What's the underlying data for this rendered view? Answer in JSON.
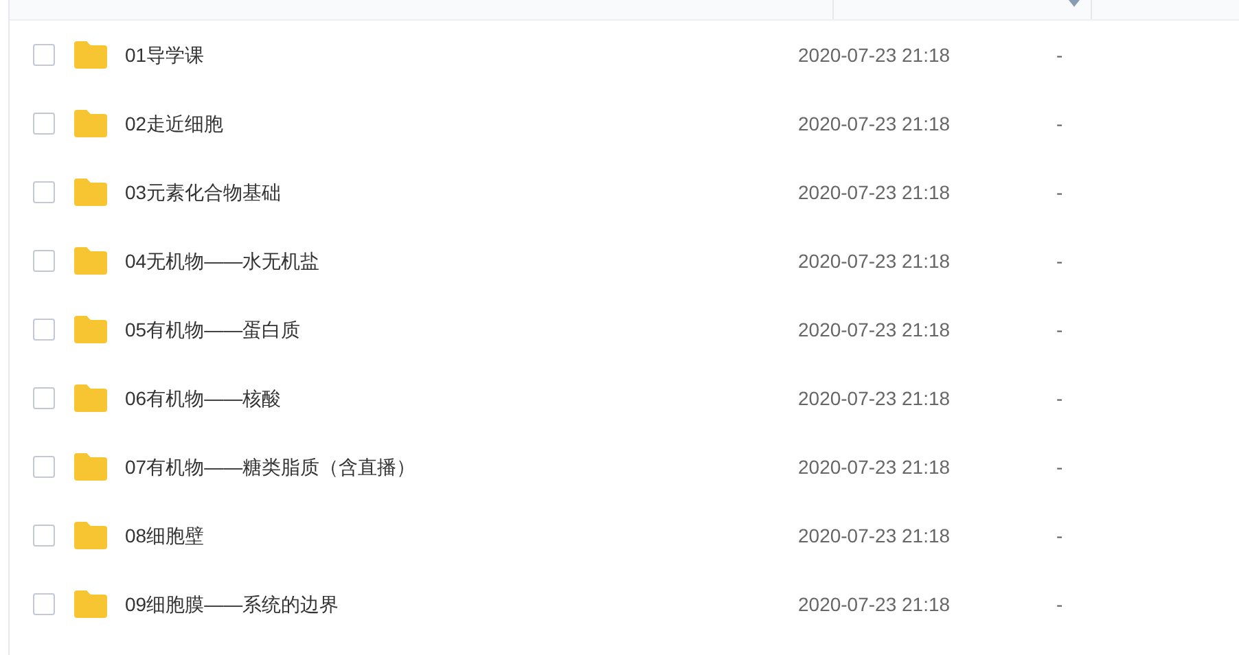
{
  "table": {
    "rows": [
      {
        "name": "01导学课",
        "modified": "2020-07-23 21:18",
        "size": "-",
        "checked": false
      },
      {
        "name": "02走近细胞",
        "modified": "2020-07-23 21:18",
        "size": "-",
        "checked": false
      },
      {
        "name": "03元素化合物基础",
        "modified": "2020-07-23 21:18",
        "size": "-",
        "checked": false
      },
      {
        "name": "04无机物——水无机盐",
        "modified": "2020-07-23 21:18",
        "size": "-",
        "checked": false
      },
      {
        "name": "05有机物——蛋白质",
        "modified": "2020-07-23 21:18",
        "size": "-",
        "checked": false
      },
      {
        "name": "06有机物——核酸",
        "modified": "2020-07-23 21:18",
        "size": "-",
        "checked": false
      },
      {
        "name": "07有机物——糖类脂质（含直播）",
        "modified": "2020-07-23 21:18",
        "size": "-",
        "checked": false
      },
      {
        "name": "08细胞壁",
        "modified": "2020-07-23 21:18",
        "size": "-",
        "checked": false
      },
      {
        "name": "09细胞膜——系统的边界",
        "modified": "2020-07-23 21:18",
        "size": "-",
        "checked": false
      }
    ]
  }
}
